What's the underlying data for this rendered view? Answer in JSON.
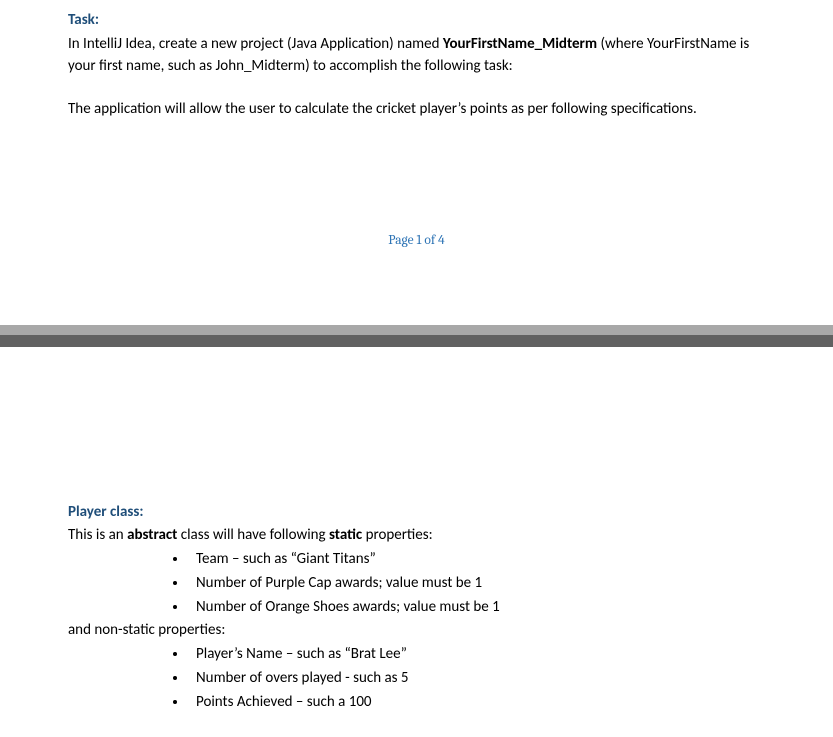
{
  "section1": {
    "heading": "Task:",
    "para1_pre": "In IntelliJ Idea, create a new project (Java Application) named ",
    "para1_bold": "YourFirstName_Midterm",
    "para1_post": " (where YourFirstName is your first name, such as John_Midterm) to accomplish the following task:",
    "para2": "The application will allow the user to calculate the cricket player’s points as per following specifications."
  },
  "footer": {
    "page_label": "Page 1 of 4"
  },
  "section2": {
    "heading": "Player class:",
    "intro_pre": "This is an ",
    "intro_b1": "abstract",
    "intro_mid": " class will have following ",
    "intro_b2": "static",
    "intro_post": " properties:",
    "static_bullets": [
      "Team – such as “Giant Titans”",
      "Number of Purple Cap awards; value must be 1",
      "Number of Orange Shoes awards; value must be 1"
    ],
    "nonstatic_intro": "and non-static properties:",
    "nonstatic_bullets": [
      "Player’s Name – such as “Brat Lee”",
      "Number of overs played - such as 5",
      "Points Achieved – such a 100"
    ]
  }
}
